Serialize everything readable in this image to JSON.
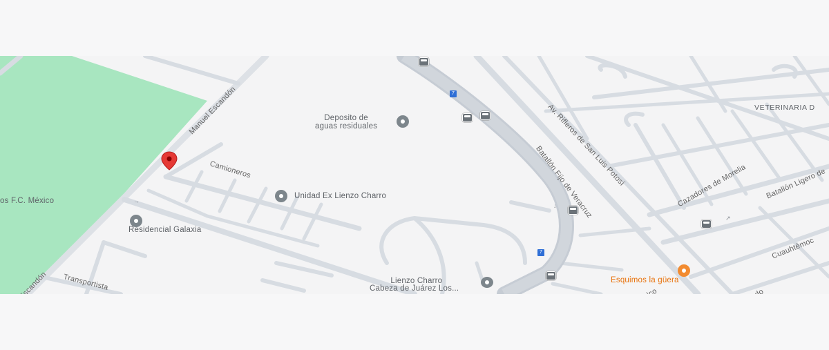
{
  "map": {
    "colors": {
      "background": "#f4f4f5",
      "road": "#d7dce2",
      "highway": "#c6ccd4",
      "park": "#a8e6c0",
      "marker": "#e53935",
      "food_poi": "#f28b30",
      "label": "#5f6368",
      "route_shield": "#2f6fd6"
    },
    "marker": {
      "icon": "map-pin-icon"
    },
    "streets": [
      {
        "id": "manuel-escandon",
        "name": "Manuel Escandón"
      },
      {
        "id": "camioneros",
        "name": "Camioneros"
      },
      {
        "id": "transportistas",
        "name": "Transportista"
      },
      {
        "id": "escandon-partial",
        "name": "Escandón"
      },
      {
        "id": "rifleros",
        "name": "Av. Rifleros de San Luis Potosí"
      },
      {
        "id": "batallon-fijo",
        "name": "Batallón Fijo de Veracruz"
      },
      {
        "id": "cazadores",
        "name": "Cazadores de Morelia"
      },
      {
        "id": "batallon-ligero",
        "name": "Batallón Ligero de"
      },
      {
        "id": "cuauhtemoc",
        "name": "Cuauhtémoc"
      },
      {
        "id": "rico",
        "name": "rico"
      },
      {
        "id": "edo",
        "name": "edo"
      }
    ],
    "pois": [
      {
        "id": "deposito",
        "name_line1": "Deposito de",
        "name_line2": "aguas residuales",
        "icon": "building-icon"
      },
      {
        "id": "unidad",
        "name": "Unidad Ex Lienzo Charro",
        "icon": "place-icon"
      },
      {
        "id": "galaxia",
        "name": "Residencial Galaxia",
        "icon": "place-icon"
      },
      {
        "id": "lienzo",
        "name_line1": "Lienzo Charro",
        "name_line2": "Cabeza de Juárez Los...",
        "icon": "school-icon"
      },
      {
        "id": "esquimos",
        "name": "Esquimos la güera",
        "icon": "food-icon"
      },
      {
        "id": "veterinaria",
        "name": "VETERINARIA D",
        "icon": ""
      },
      {
        "id": "fc-mexico",
        "name": "os F.C. México",
        "icon": ""
      }
    ],
    "route_shields": [
      "7",
      "7"
    ]
  }
}
